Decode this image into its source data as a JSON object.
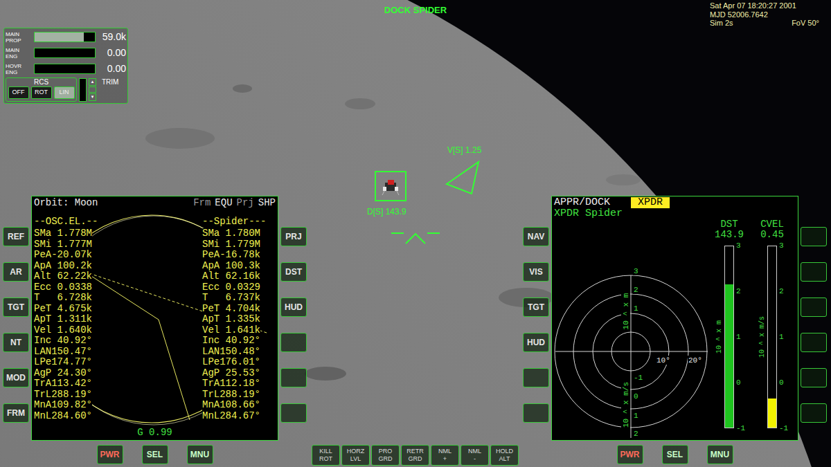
{
  "hud": {
    "title": "DOCK SPIDER",
    "target_velocity": "V[S] 1.25",
    "target_distance": "D[S] 143.9"
  },
  "clock": {
    "date": "Sat Apr 07 18:20:27 2001",
    "mjd": "MJD 52006.7642",
    "sim": "Sim 2s",
    "fov": "FoV 50°"
  },
  "engine_panel": {
    "gauges": [
      {
        "label": [
          "MAIN",
          "PROP"
        ],
        "level": 0.82,
        "reading": "59.0k"
      },
      {
        "label": [
          "MAIN",
          "ENG"
        ],
        "level": 0,
        "reading": "0.00"
      },
      {
        "label": [
          "HOVR",
          "ENG"
        ],
        "level": 0,
        "reading": "0.00"
      }
    ],
    "rcs": {
      "label": "RCS",
      "modes": [
        {
          "label": "OFF",
          "selected": false
        },
        {
          "label": "ROT",
          "selected": false
        },
        {
          "label": "LIN",
          "selected": true
        }
      ]
    },
    "trim": {
      "label": "TRIM",
      "up": "▲",
      "down": "▼",
      "level": 0
    }
  },
  "orbit_mfd": {
    "left_buttons": [
      "REF",
      "AR",
      "TGT",
      "NT",
      "MOD",
      "FRM"
    ],
    "right_buttons": [
      "PRJ",
      "DST",
      "HUD",
      "",
      "",
      ""
    ],
    "bottom_buttons": [
      {
        "label": "PWR",
        "color": "#ff6a5a"
      },
      {
        "label": "SEL",
        "color": "#c8ffc8"
      },
      {
        "label": "MNU",
        "color": "#c8ffc8"
      }
    ],
    "header": {
      "title": "Orbit: Moon",
      "frame_label": "Frm",
      "frame": "EQU",
      "projection_label": "Prj",
      "projection": "SHP"
    },
    "columns": [
      "--OSC.EL.--",
      "--Spider---"
    ],
    "rows": [
      {
        "label": "SMa",
        "own": "1.778M",
        "target": "1.780M"
      },
      {
        "label": "SMi",
        "own": "1.777M",
        "target": "1.779M"
      },
      {
        "label": "PeA",
        "own": "-20.07k",
        "target": "-16.78k"
      },
      {
        "label": "ApA",
        "own": "100.2k",
        "target": "100.3k"
      },
      {
        "label": "Alt",
        "own": "62.22k",
        "target": "62.16k"
      },
      {
        "label": "Ecc",
        "own": "0.0338",
        "target": "0.0329"
      },
      {
        "label": "T",
        "own": "6.728k",
        "target": "6.737k"
      },
      {
        "label": "PeT",
        "own": "4.675k",
        "target": "4.704k"
      },
      {
        "label": "ApT",
        "own": "1.311k",
        "target": "1.335k"
      },
      {
        "label": "Vel",
        "own": "1.640k",
        "target": "1.641k"
      },
      {
        "label": "Inc",
        "own": "40.92°",
        "target": "40.92°"
      },
      {
        "label": "LAN",
        "own": "150.47°",
        "target": "150.48°"
      },
      {
        "label": "LPe",
        "own": "174.77°",
        "target": "176.01°"
      },
      {
        "label": "AgP",
        "own": "24.30°",
        "target": "25.53°"
      },
      {
        "label": "TrA",
        "own": "113.42°",
        "target": "112.18°"
      },
      {
        "label": "TrL",
        "own": "288.19°",
        "target": "288.19°"
      },
      {
        "label": "MnA",
        "own": "109.82°",
        "target": "108.66°"
      },
      {
        "label": "MnL",
        "own": "284.60°",
        "target": "284.67°"
      }
    ],
    "footer": "G 0.99"
  },
  "autopilot_buttons": [
    {
      "lines": [
        "KILL",
        "ROT"
      ]
    },
    {
      "lines": [
        "HORZ",
        "LVL"
      ]
    },
    {
      "lines": [
        "PRO",
        "GRD"
      ]
    },
    {
      "lines": [
        "RETR",
        "GRD"
      ]
    },
    {
      "lines": [
        "NML",
        "+"
      ]
    },
    {
      "lines": [
        "NML",
        "-"
      ]
    },
    {
      "lines": [
        "HOLD",
        "ALT"
      ]
    }
  ],
  "dock_mfd": {
    "left_buttons": [
      "NAV",
      "VIS",
      "TGT",
      "HUD",
      "",
      ""
    ],
    "right_buttons": [
      "",
      "",
      "",
      "",
      "",
      ""
    ],
    "bottom_buttons": [
      {
        "label": "PWR",
        "color": "#ff6a5a"
      },
      {
        "label": "SEL",
        "color": "#c8ffc8"
      },
      {
        "label": "MNU",
        "color": "#c8ffc8"
      }
    ],
    "mode": "APPR/DOCK",
    "source": {
      "label": "XPDR",
      "highlighted": true
    },
    "target": "XPDR Spider",
    "gauges": [
      {
        "label": "DST",
        "reading": "143.9",
        "level": 0.79,
        "color": "#1fc41f",
        "unit": "10 ^ x m",
        "ticks": [
          "3",
          "2",
          "1",
          "0",
          "-1"
        ]
      },
      {
        "label": "CVEL",
        "reading": "0.45",
        "level": 0.16,
        "color": "#f2f200",
        "unit": "10 ^ x m/s",
        "ticks": [
          "3",
          "2",
          "1",
          "0",
          "-1"
        ]
      }
    ],
    "polar": {
      "distance_ticks": [
        "3",
        "2",
        "1"
      ],
      "distance_unit": "10 ^ x m",
      "velocity_ticks": [
        "-1",
        "0",
        "1",
        "2"
      ],
      "velocity_unit": "10 ^ x m/s",
      "angle_ticks": [
        "10°",
        "20°"
      ]
    }
  }
}
